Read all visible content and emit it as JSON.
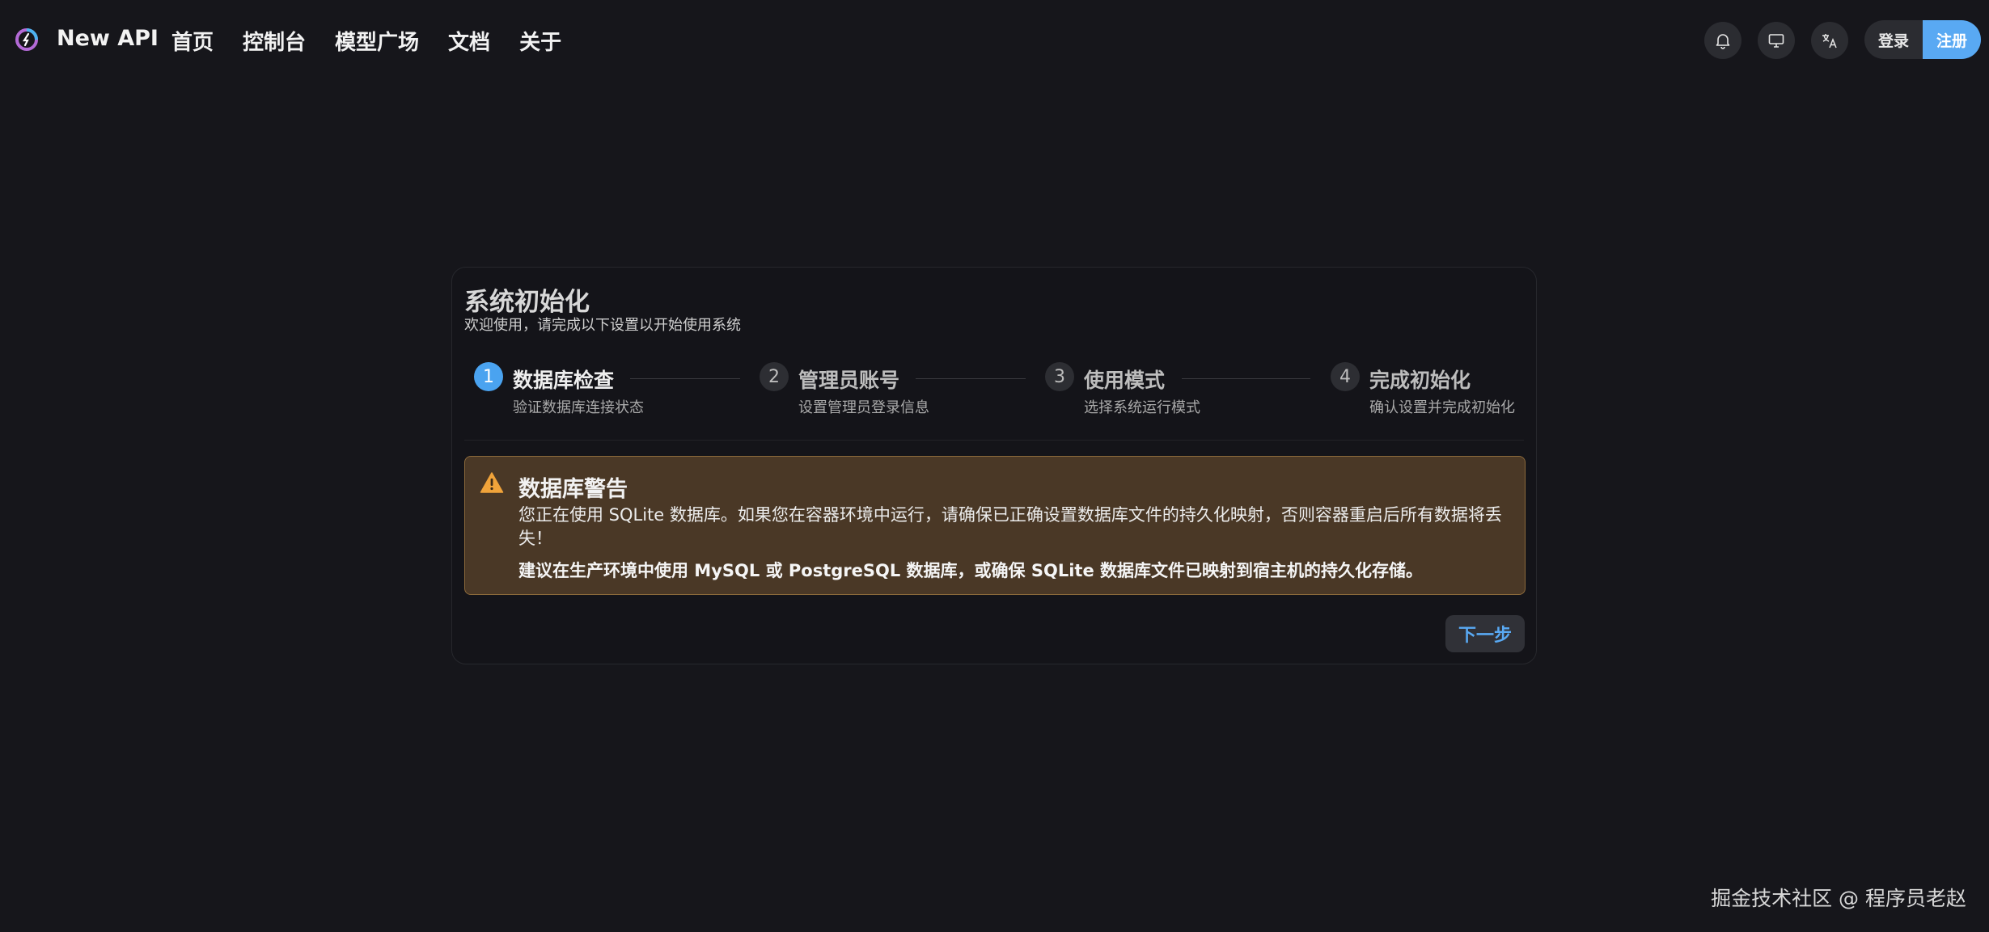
{
  "header": {
    "brand": "New API",
    "nav": [
      "首页",
      "控制台",
      "模型广场",
      "文档",
      "关于"
    ],
    "icons": [
      "bell-icon",
      "monitor-icon",
      "translate-icon"
    ],
    "login_label": "登录",
    "register_label": "注册"
  },
  "setup": {
    "title": "系统初始化",
    "subtitle": "欢迎使用，请完成以下设置以开始使用系统",
    "steps": [
      {
        "num": "1",
        "label": "数据库检查",
        "desc": "验证数据库连接状态"
      },
      {
        "num": "2",
        "label": "管理员账号",
        "desc": "设置管理员登录信息"
      },
      {
        "num": "3",
        "label": "使用模式",
        "desc": "选择系统运行模式"
      },
      {
        "num": "4",
        "label": "完成初始化",
        "desc": "确认设置并完成初始化"
      }
    ],
    "alert": {
      "title": "数据库警告",
      "body": "您正在使用 SQLite 数据库。如果您在容器环境中运行，请确保已正确设置数据库文件的持久化映射，否则容器重启后所有数据将丢失！",
      "strong": "建议在生产环境中使用 MySQL 或 PostgreSQL 数据库，或确保 SQLite 数据库文件已映射到宿主机的持久化存储。"
    },
    "next_label": "下一步"
  },
  "watermark": "掘金技术社区 @ 程序员老赵",
  "colors": {
    "accent": "#59a9f3",
    "warning": "#f0a33a",
    "alert_bg": "#4a3826"
  }
}
